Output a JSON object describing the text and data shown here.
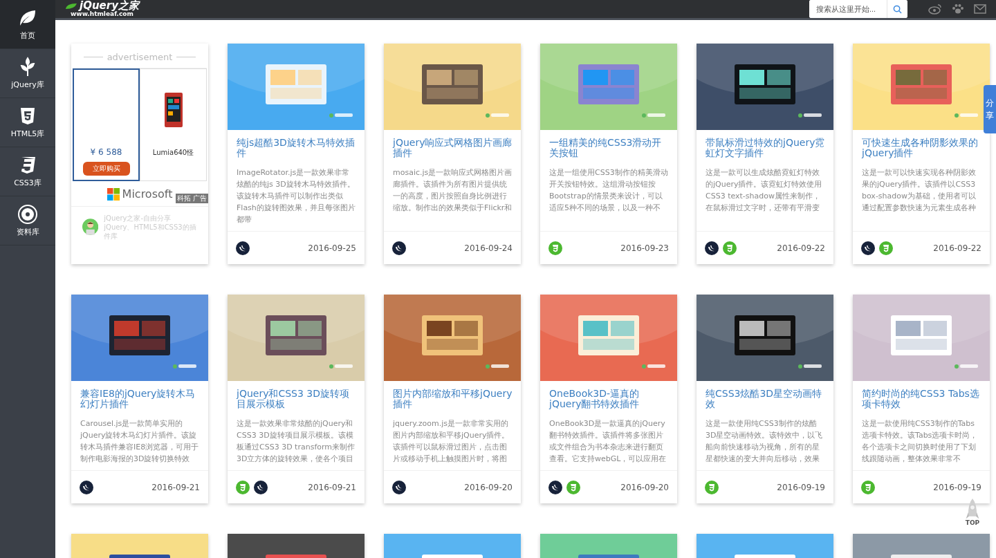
{
  "sidebar": {
    "items": [
      {
        "label": "首页",
        "kind": "home",
        "selected": true
      },
      {
        "label": "jQuery库",
        "kind": "jquery",
        "selected": false
      },
      {
        "label": "HTML5库",
        "kind": "html5",
        "selected": false
      },
      {
        "label": "CSS3库",
        "kind": "css3",
        "selected": false
      },
      {
        "label": "资料库",
        "kind": "resources",
        "selected": false
      }
    ]
  },
  "header": {
    "logo": "jQuery之家",
    "site": "www.htmleaf.com",
    "search": {
      "placeholder": "搜索从这里开始..."
    }
  },
  "ad": {
    "heading": "advertisement",
    "price": "¥ 6 588",
    "buy": "立即购买",
    "product": "Lumia640怪",
    "brand": "Microsoft",
    "label": "科拓 广告",
    "tagline": "jQuery之家-自由分享jQuery、HTML5和CSS3的插件库"
  },
  "cards": [
    {
      "title": "纯js超酷3D旋转木马特效插件",
      "description": "ImageRotator.js是一款效果非常炫酷的纯js 3D旋转木马特效插件。该旋转木马插件可以制作出类似Flash的旋转图效果，并且每张图片都带",
      "tags": [
        {
          "kind": "jquery"
        }
      ],
      "date": "2016-09-25"
    },
    {
      "title": "jQuery响应式网格图片画廊插件",
      "description": "mosaic.js是一款响应式网格图片画廊插件。该插件为所有图片提供统一的高度，图片按照自身比例进行缩放。制作出的效果类似于Flickr和",
      "tags": [
        {
          "kind": "jquery"
        }
      ],
      "date": "2016-09-24"
    },
    {
      "title": "一组精美的纯CSS3滑动开关按钮",
      "description": "这是一组使用CSS3制作的精美滑动开关按钮特效。这组滑动按钮按Bootstrap的情景类来设计，可以适应5种不同的场景，以及一种不",
      "tags": [
        {
          "kind": "css3"
        }
      ],
      "date": "2016-09-23"
    },
    {
      "title": "带鼠标滑过特效的jQuery霓虹灯文字插件",
      "description": "这是一款可以生成炫酷霓虹灯特效的jQuery插件。该霓虹灯特效使用CSS3 text-shadow属性来制作，在鼠标滑过文字时，还带有平滑变",
      "tags": [
        {
          "kind": "jquery"
        },
        {
          "kind": "css3"
        }
      ],
      "date": "2016-09-22"
    },
    {
      "title": "可快速生成各种阴影效果的jQuery插件",
      "description": "这是一款可以快速实现各种阴影效果的jQuery插件。该插件以CSS3 box-shadow为基础，使用者可以通过配置参数快速为元素生成各种",
      "tags": [
        {
          "kind": "jquery"
        },
        {
          "kind": "css3"
        }
      ],
      "date": "2016-09-22"
    },
    {
      "title": "兼容IE8的jQuery旋转木马幻灯片插件",
      "description": "Carousel.js是一款简单实用的jQuery旋转木马幻灯片插件。该旋转木马插件兼容IE8浏览器，可用于制作电影海报的3D旋转切换特效",
      "tags": [
        {
          "kind": "jquery"
        }
      ],
      "date": "2016-09-21"
    },
    {
      "title": "jQuery和CSS3 3D旋转项目展示模板",
      "description": "这是一款效果非常炫酷的jQuery和CSS3 3D旋转项目展示模板。该模板通过CSS3 3D transform来制作3D立方体的旋转效果，使各个项目",
      "tags": [
        {
          "kind": "css3"
        },
        {
          "kind": "jquery"
        }
      ],
      "date": "2016-09-21"
    },
    {
      "title": "图片内部缩放和平移jQuery插件",
      "description": "jquery.zoom.js是一款非常实用的图片内部缩放和平移jQuery插件。该插件可以鼠标滑过图片，点击图片或移动手机上触摸图片时，将图",
      "tags": [
        {
          "kind": "jquery"
        }
      ],
      "date": "2016-09-20"
    },
    {
      "title": "OneBook3D-逼真的jQuery翻书特效插件",
      "description": "OneBook3D是一款逼真的jQuery翻书特效插件。该插件将多张图片或文件组合为书本杂志来进行翻页查看。它支持webGL，可以应用在",
      "tags": [
        {
          "kind": "jquery"
        },
        {
          "kind": "css3"
        }
      ],
      "date": "2016-09-20"
    },
    {
      "title": "纯CSS3炫酷3D星空动画特效",
      "description": "这是一款使用纯CSS3制作的炫酷3D星空动画特效。该特效中，以飞船向前快速移动为视角，所有的星星都快速的变大并向后移动，效果",
      "tags": [
        {
          "kind": "css3"
        }
      ],
      "date": "2016-09-19"
    },
    {
      "title": "简约时尚的纯CSS3 Tabs选项卡特效",
      "description": "这是一款使用纯CSS3制作的Tabs选项卡特效。该Tabs选项卡时尚，各个选项卡之间切换时使用了下划线跟随动画，整体效果非常不",
      "tags": [
        {
          "kind": "css3"
        }
      ],
      "date": "2016-09-19"
    }
  ],
  "share": {
    "label": "分享"
  },
  "back_to_top": {
    "label": "TOP"
  }
}
